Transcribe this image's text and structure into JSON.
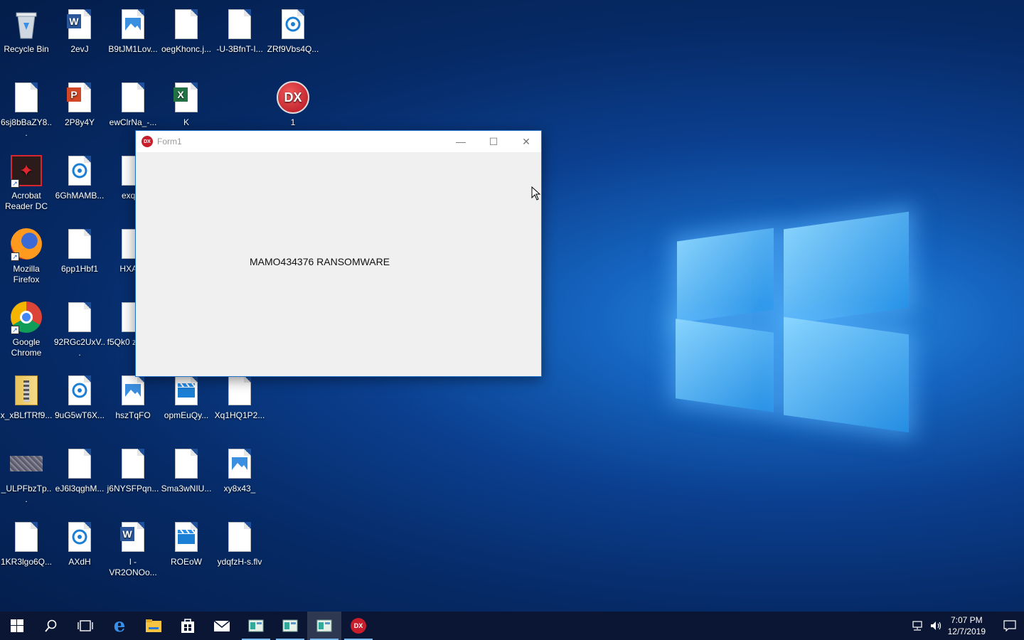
{
  "window": {
    "title": "Form1",
    "message": "MAMO434376 RANSOMWARE",
    "minimize": "—",
    "maximize": "☐",
    "close": "✕",
    "icon_text": "DX"
  },
  "desktop_icons": [
    {
      "label": "Recycle Bin",
      "icon": "recycle-bin-icon"
    },
    {
      "label": "2evJ",
      "icon": "word-doc-icon"
    },
    {
      "label": "B9tJM1Lov...",
      "icon": "image-file-icon"
    },
    {
      "label": "oegKhonc.j...",
      "icon": "blank-file-icon"
    },
    {
      "label": "-U-3BfnT-I...",
      "icon": "blank-file-icon"
    },
    {
      "label": "ZRf9Vbs4Q...",
      "icon": "media-file-icon"
    },
    {
      "label": "6sj8bBaZY8...",
      "icon": "blank-file-icon"
    },
    {
      "label": "2P8y4Y",
      "icon": "powerpoint-doc-icon"
    },
    {
      "label": "ewClrNa_-...",
      "icon": "blank-file-icon"
    },
    {
      "label": "K",
      "icon": "excel-doc-icon"
    },
    {
      "label": "1",
      "icon": "dx-app-icon"
    },
    {
      "label": "Acrobat Reader DC",
      "icon": "acrobat-icon"
    },
    {
      "label": "6GhMAMB...",
      "icon": "media-file-icon"
    },
    {
      "label": "exq_fl",
      "icon": "blank-file-icon"
    },
    {
      "label": "Mozilla Firefox",
      "icon": "firefox-icon"
    },
    {
      "label": "6pp1Hbf1",
      "icon": "blank-file-icon"
    },
    {
      "label": "HXAy7",
      "icon": "blank-file-icon"
    },
    {
      "label": "Google Chrome",
      "icon": "chrome-icon"
    },
    {
      "label": "92RGc2UxV...",
      "icon": "blank-file-icon"
    },
    {
      "label": "f5Qk0 zqGwu",
      "icon": "blank-file-icon"
    },
    {
      "label": "x_xBLfTRf9...",
      "icon": "archive-file-icon"
    },
    {
      "label": "9uG5wT6X...",
      "icon": "media-file-icon"
    },
    {
      "label": "hszTqFO",
      "icon": "image-file-icon"
    },
    {
      "label": "opmEuQy...",
      "icon": "video-file-icon"
    },
    {
      "label": "Xq1HQ1P2...",
      "icon": "blank-file-icon"
    },
    {
      "label": "_ULPFbzTp...",
      "icon": "noise-image-icon"
    },
    {
      "label": "eJ6l3qghM...",
      "icon": "blank-file-icon"
    },
    {
      "label": "j6NYSFPqn...",
      "icon": "blank-file-icon"
    },
    {
      "label": "Sma3wNIU...",
      "icon": "blank-file-icon"
    },
    {
      "label": "xy8x43_",
      "icon": "image-file-icon"
    },
    {
      "label": "1KR3lgo6Q...",
      "icon": "blank-file-icon"
    },
    {
      "label": "AXdH",
      "icon": "media-file-icon"
    },
    {
      "label": "l -VR2ONOo...",
      "icon": "word-doc-icon"
    },
    {
      "label": "ROEoW",
      "icon": "video-file-icon"
    },
    {
      "label": "ydqfzH-s.flv",
      "icon": "blank-file-icon"
    }
  ],
  "taskbar": {
    "time": "7:07 PM",
    "date": "12/7/2019"
  },
  "colors": {
    "accent": "#1f72c9",
    "taskbar": "#0a1633",
    "dx_red": "#c81e2b"
  }
}
